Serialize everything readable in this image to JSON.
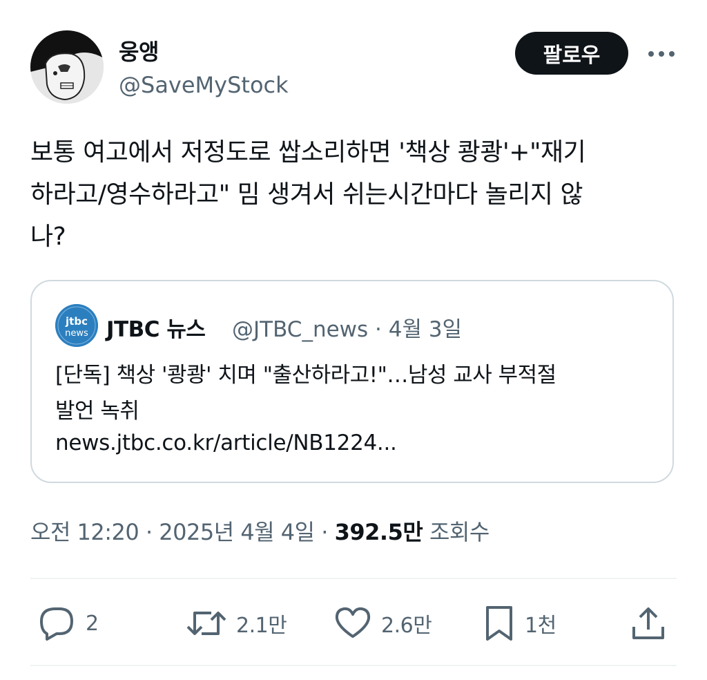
{
  "author": {
    "display_name": "웅앵",
    "handle": "@SaveMyStock"
  },
  "follow_label": "팔로우",
  "tweet": {
    "text": "보통 여고에서 저정도로 쌉소리하면 '책상 쾅쾅'+\"재기\n하라고/영수하라고\" 밈 생겨서 쉬는시간마다 놀리지 않\n나?"
  },
  "quote": {
    "avatar_text_top": "jtbc",
    "avatar_text_bottom": "news",
    "name": "JTBC 뉴스",
    "meta": "@JTBC_news · 4월 3일",
    "title": "[단독] 책상 '쾅쾅' 치며 \"출산하라고!\"…남성 교사 부적절\n발언 녹취",
    "link": "news.jtbc.co.kr/article/NB1224..."
  },
  "timestamp": {
    "time": "오전 12:20 · 2025년 4월 4일 · ",
    "views_count": "392.5만",
    "views_label": " 조회수"
  },
  "actions": {
    "replies": "2",
    "retweets": "2.1만",
    "likes": "2.6만",
    "bookmarks": "1천"
  },
  "colors": {
    "text": "#0f1419",
    "secondary": "#536471",
    "border": "#cfd9de",
    "button_bg": "#0f1419"
  }
}
